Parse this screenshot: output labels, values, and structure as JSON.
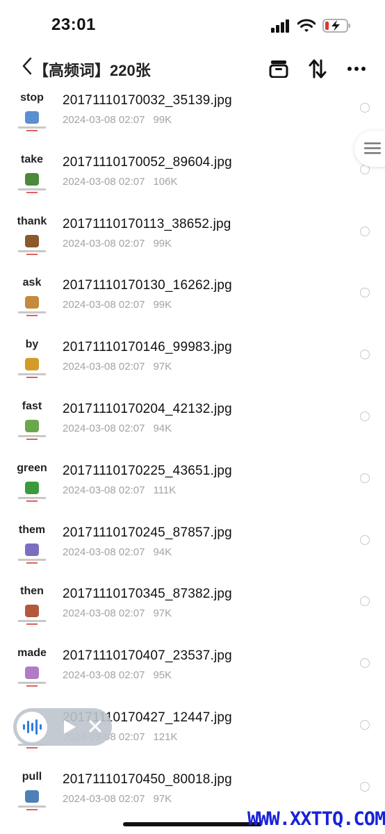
{
  "status": {
    "time": "23:01"
  },
  "nav": {
    "back_icon": "chevron-left-icon",
    "title": "【高频词】220张"
  },
  "files": [
    {
      "word": "stop",
      "name": "20171110170032_35139.jpg",
      "date": "2024-03-08 02:07",
      "size": "99K",
      "color": "#5b8fd1"
    },
    {
      "word": "take",
      "name": "20171110170052_89604.jpg",
      "date": "2024-03-08 02:07",
      "size": "106K",
      "color": "#4a8a3a"
    },
    {
      "word": "thank",
      "name": "20171110170113_38652.jpg",
      "date": "2024-03-08 02:07",
      "size": "99K",
      "color": "#8b5a2b"
    },
    {
      "word": "ask",
      "name": "20171110170130_16262.jpg",
      "date": "2024-03-08 02:07",
      "size": "99K",
      "color": "#c68a3c"
    },
    {
      "word": "by",
      "name": "20171110170146_99983.jpg",
      "date": "2024-03-08 02:07",
      "size": "97K",
      "color": "#d39b2a"
    },
    {
      "word": "fast",
      "name": "20171110170204_42132.jpg",
      "date": "2024-03-08 02:07",
      "size": "94K",
      "color": "#6aa84f"
    },
    {
      "word": "green",
      "name": "20171110170225_43651.jpg",
      "date": "2024-03-08 02:07",
      "size": "111K",
      "color": "#3c9a3c"
    },
    {
      "word": "them",
      "name": "20171110170245_87857.jpg",
      "date": "2024-03-08 02:07",
      "size": "94K",
      "color": "#7a6fbf"
    },
    {
      "word": "then",
      "name": "20171110170345_87382.jpg",
      "date": "2024-03-08 02:07",
      "size": "97K",
      "color": "#b3583b"
    },
    {
      "word": "made",
      "name": "20171110170407_23537.jpg",
      "date": "2024-03-08 02:07",
      "size": "95K",
      "color": "#b07cc6"
    },
    {
      "word": "",
      "name": "20171110170427_12447.jpg",
      "date": "2024-03-08 02:07",
      "size": "121K",
      "color": "#9aa5b1"
    },
    {
      "word": "pull",
      "name": "20171110170450_80018.jpg",
      "date": "2024-03-08 02:07",
      "size": "97K",
      "color": "#4f7fb8"
    }
  ],
  "watermark": "WWW.XXTTQ.COM",
  "icons": {
    "signal": "signal-icon",
    "wifi": "wifi-icon",
    "battery": "battery-charging-icon",
    "archive": "archive-icon",
    "sort": "sort-icon",
    "more": "more-icon",
    "menu": "menu-icon",
    "voice": "voice-wave-icon",
    "play": "play-icon",
    "close": "close-icon"
  },
  "colors": {
    "battery_low": "#e0352b",
    "watermark": "#1a22d8"
  }
}
